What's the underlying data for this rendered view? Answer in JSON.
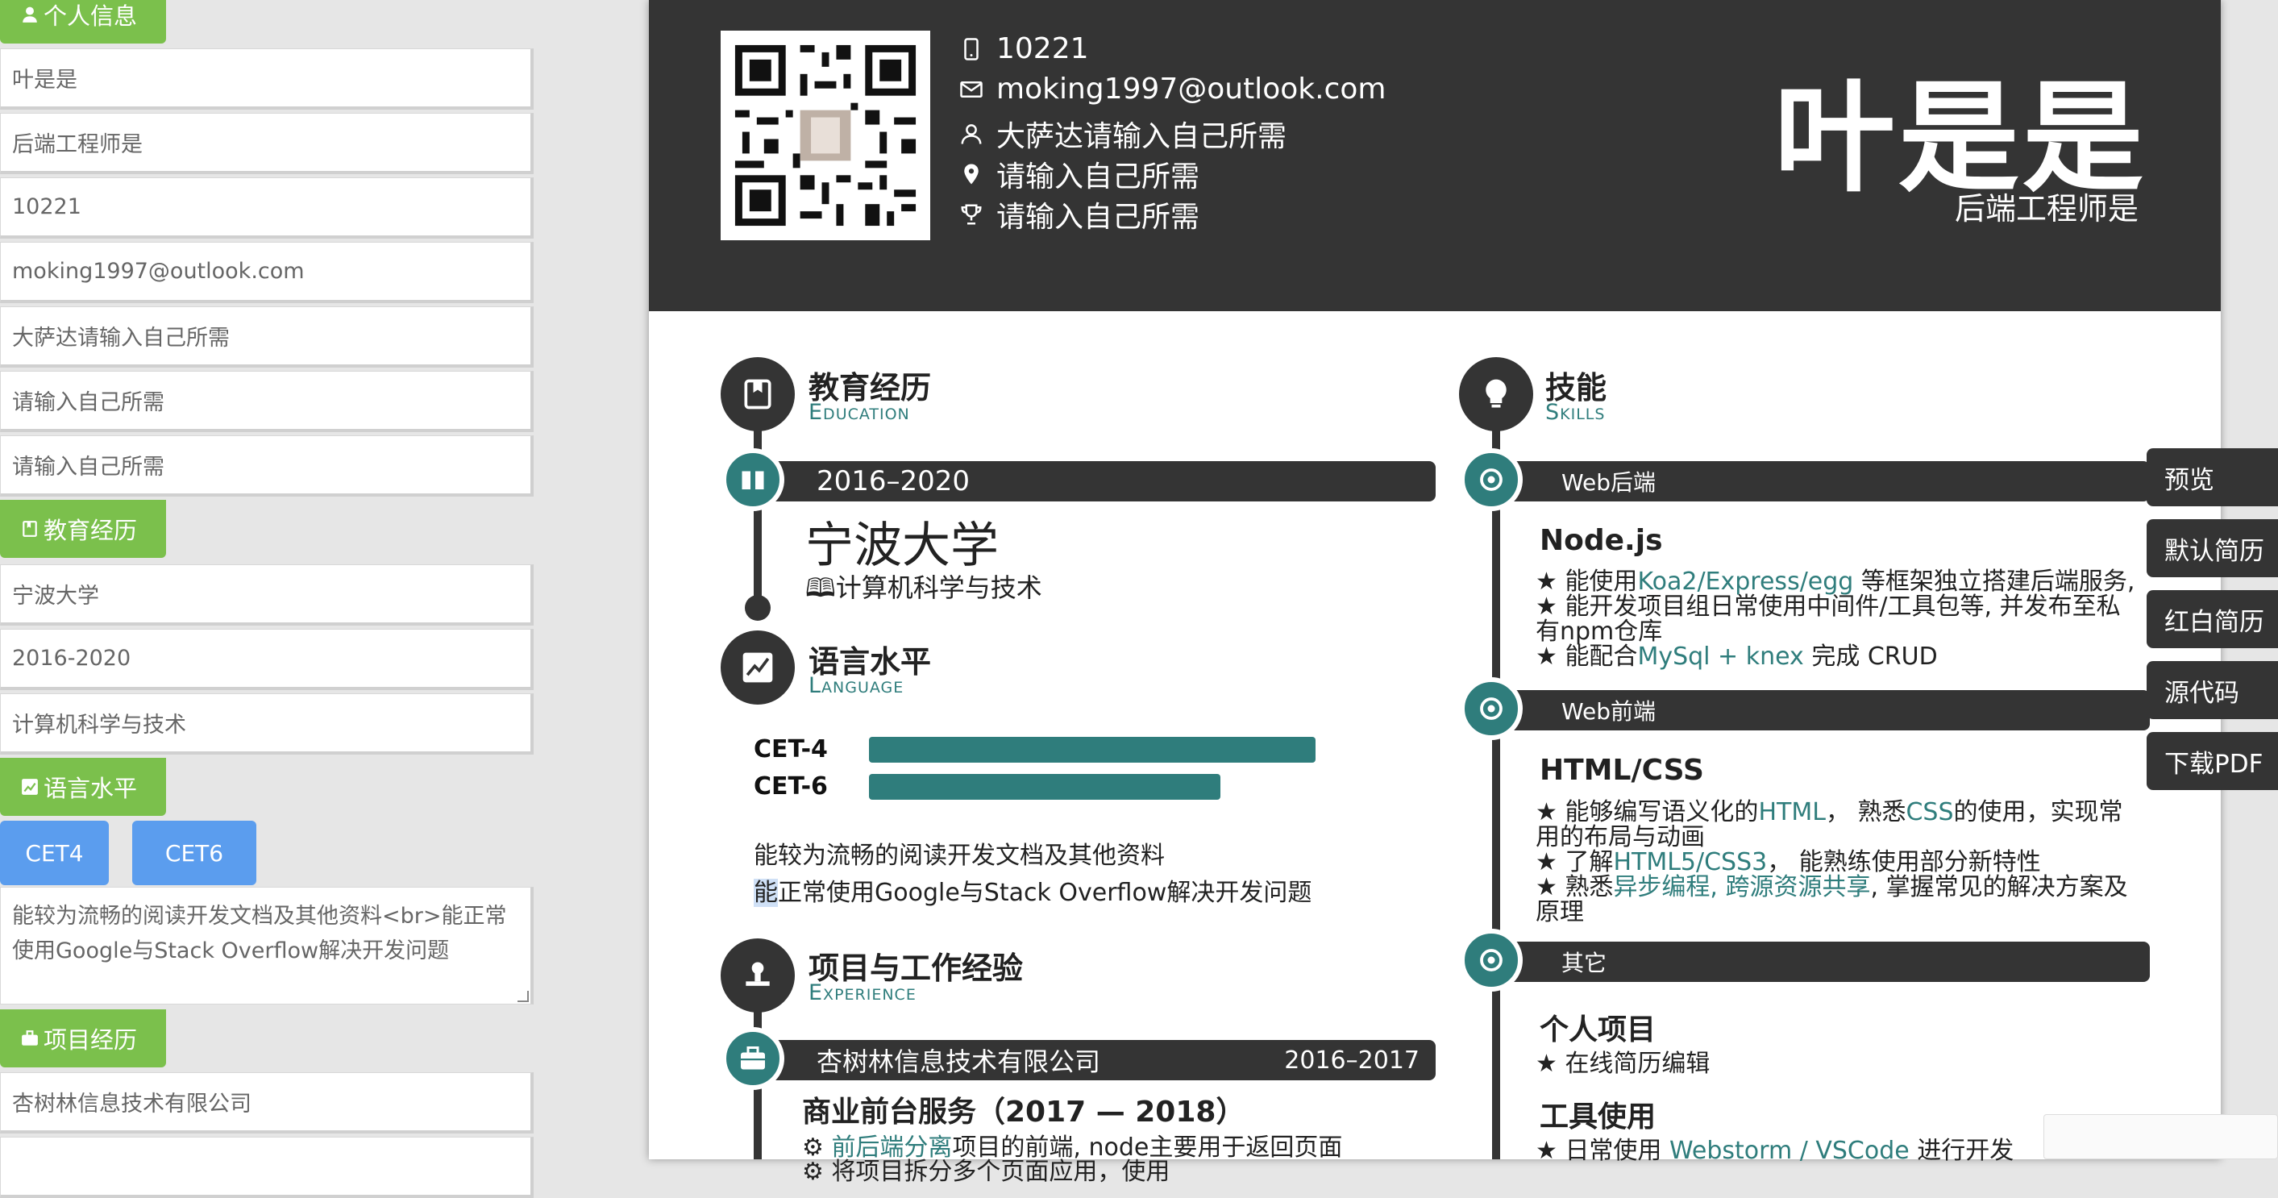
{
  "editor": {
    "personal_btn": "个人信息",
    "name": "叶是是",
    "title": "后端工程师是",
    "phone": "10221",
    "email": "moking1997@outlook.com",
    "field5": "大萨达请输入自己所需",
    "field6": "请输入自己所需",
    "field7": "请输入自己所需",
    "education_btn": "教育经历",
    "school": " 宁波大学",
    "years": "2016-2020",
    "major": "计算机科学与技术",
    "language_btn": "语言水平",
    "chip1": "CET4",
    "chip2": "CET6",
    "language_text": "能较为流畅的阅读开发文档及其他资料<br>能正常使用Google与Stack Overflow解决开发问题",
    "project_btn": "项目经历",
    "company": "杏树林信息技术有限公司"
  },
  "resume": {
    "phone": "10221",
    "email": "moking1997@outlook.com",
    "contact3": "大萨达请输入自己所需",
    "contact4": "请输入自己所需",
    "contact5": "请输入自己所需",
    "name": "叶是是",
    "title": "后端工程师是",
    "education": {
      "title": "教育经历",
      "sub": "Education",
      "years": "2016–2020",
      "school": "宁波大学",
      "major": "计算机科学与技术"
    },
    "language": {
      "title": "语言水平",
      "sub": "Language",
      "levels": [
        {
          "label": "CET-4",
          "fill": 0.84
        },
        {
          "label": "CET-6",
          "fill": 0.66
        }
      ],
      "line1": "能较为流畅的阅读开发文档及其他资料",
      "line2_hl": "能",
      "line2_rest": "正常使用Google与Stack Overflow解决开发问题"
    },
    "experience": {
      "title": "项目与工作经验",
      "sub": "Experience",
      "company": "杏树林信息技术有限公司",
      "years": "2016–2017",
      "project": "商业前台服务（2017 — 2018）",
      "line1_teal": "前后端分离",
      "line1_rest": "项目的前端, node主要用于返回页面",
      "line2": "将项目拆分多个页面应用，使用"
    },
    "skills": {
      "title": "技能",
      "sub": "Skills",
      "groups": [
        {
          "bar": "Web后端",
          "heading": "Node.js",
          "l1_a": "能使用",
          "l1_teal": "Koa2/Express/egg",
          "l1_b": " 等框架独立搭建后端服务,",
          "l2": "能开发项目组日常使用中间件/工具包等, 并发布至私",
          "l2b": "有npm仓库",
          "l3_a": "能配合",
          "l3_teal": "MySql + knex",
          "l3_b": " 完成 CRUD"
        },
        {
          "bar": "Web前端",
          "heading": "HTML/CSS",
          "l1_a": "能够编写语义化的",
          "l1_teal": "HTML",
          "l1_b": "， 熟悉",
          "l1_teal2": "CSS",
          "l1_c": "的使用，实现常",
          "l1d": "用的布局与动画",
          "l2_a": "了解",
          "l2_teal": "HTML5/CSS3",
          "l2_b": "， 能熟练使用部分新特性",
          "l3_a": "熟悉",
          "l3_teal": "异步编程, 跨源资源共享",
          "l3_b": ", 掌握常见的解决方案及",
          "l3d": "原理"
        },
        {
          "bar": "其它",
          "heading": "个人项目",
          "l1": "在线简历编辑",
          "heading2": "工具使用",
          "l2_a": "日常使用 ",
          "l2_teal": "Webstorm / VSCode",
          "l2_b": " 进行开发"
        }
      ]
    }
  },
  "floating": [
    "预览",
    "默认简历",
    "红白简历",
    "源代码",
    "下载PDF"
  ],
  "colors": {
    "accent_green": "#7bc04c",
    "chip_blue": "#5b9dee",
    "dark": "#343434",
    "teal": "#2f7d7c"
  }
}
